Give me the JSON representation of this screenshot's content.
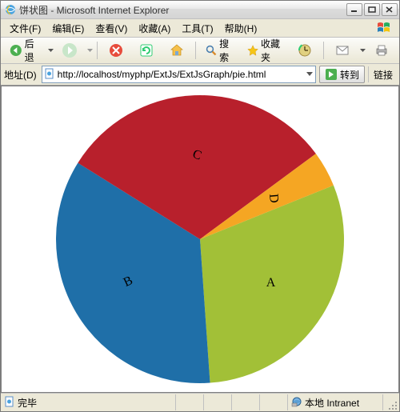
{
  "window": {
    "title": "饼状图 - Microsoft Internet Explorer"
  },
  "menus": {
    "file": "文件(F)",
    "edit": "编辑(E)",
    "view": "查看(V)",
    "favorites": "收藏(A)",
    "tools": "工具(T)",
    "help": "帮助(H)"
  },
  "toolbar": {
    "back_label": "后退",
    "search_label": "搜索",
    "favorites_label": "收藏夹"
  },
  "address": {
    "label": "地址(D)",
    "value": "http://localhost/myphp/ExtJs/ExtJsGraph/pie.html",
    "go_label": "转到",
    "links_label": "链接"
  },
  "status": {
    "text": "完毕",
    "zone_label": "本地 Intranet"
  },
  "chart_colors": {
    "A": "#a2c037",
    "B": "#1f6fa8",
    "C": "#b8202c",
    "D": "#f5a623"
  },
  "chart_data": {
    "type": "pie",
    "title": "",
    "series": [
      {
        "name": "A",
        "value": 30
      },
      {
        "name": "B",
        "value": 35
      },
      {
        "name": "C",
        "value": 31
      },
      {
        "name": "D",
        "value": 4
      }
    ]
  }
}
